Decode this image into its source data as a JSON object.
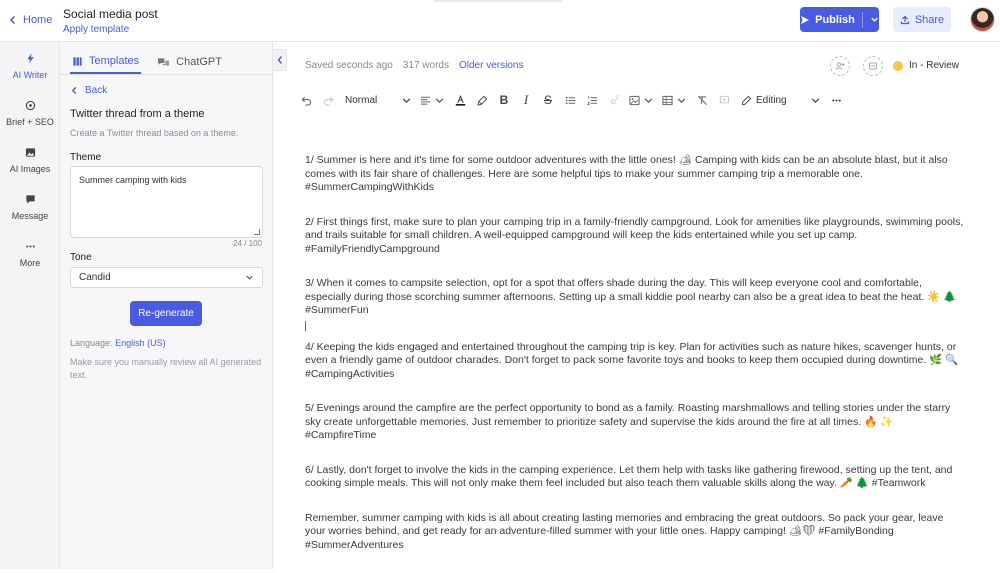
{
  "header": {
    "home_label": "Home",
    "doc_title": "Social media post",
    "apply_template": "Apply template",
    "publish_label": "Publish",
    "share_label": "Share"
  },
  "rail": {
    "items": [
      {
        "label": "AI Writer",
        "icon": "bolt-icon"
      },
      {
        "label": "Brief + SEO",
        "icon": "target-icon"
      },
      {
        "label": "AI Images",
        "icon": "image-icon"
      },
      {
        "label": "Message",
        "icon": "chat-icon"
      },
      {
        "label": "More",
        "icon": "more-icon"
      }
    ]
  },
  "panel": {
    "tabs": [
      "Templates",
      "ChatGPT"
    ],
    "back_label": "Back",
    "title": "Twitter thread from a theme",
    "subtitle": "Create a Twitter thread based on a theme.",
    "theme_label": "Theme",
    "theme_value": "Summer camping with kids",
    "char_count": "24 / 100",
    "tone_label": "Tone",
    "tone_value": "Candid",
    "regenerate_label": "Re-generate",
    "language_prefix": "Language:",
    "language_value": "English (US)",
    "note": "Make sure you manually review all AI generated text."
  },
  "editor_status": {
    "saved": "Saved seconds ago",
    "words": "317 words",
    "older_versions": "Older versions",
    "review_status": "In - Review"
  },
  "toolbar": {
    "style_value": "Normal",
    "mode_value": "Editing"
  },
  "content": {
    "paragraphs": [
      "1/ Summer is here and it's time for some outdoor adventures with the little ones! 🏕 Camping with kids can be an absolute blast, but it also comes with its fair share of challenges. Here are some helpful tips to make your summer camping trip a memorable one. #SummerCampingWithKids",
      "2/ First things first, make sure to plan your camping trip in a family-friendly campground. Look for amenities like playgrounds, swimming pools, and trails suitable for small children. A well-equipped campground will keep the kids entertained while you set up camp. #FamilyFriendlyCampground",
      "3/ When it comes to campsite selection, opt for a spot that offers shade during the day. This will keep everyone cool and comfortable, especially during those scorching summer afternoons. Setting up a small kiddie pool nearby can also be a great idea to beat the heat. ☀️ 🌲 #SummerFun",
      "4/ Keeping the kids engaged and entertained throughout the camping trip is key. Plan for activities such as nature hikes, scavenger hunts, or even a friendly game of outdoor charades. Don't forget to pack some favorite toys and books to keep them occupied during downtime. 🌿 🔍 #CampingActivities",
      "5/ Evenings around the campfire are the perfect opportunity to bond as a family. Roasting marshmallows and telling stories under the starry sky create unforgettable memories. Just remember to prioritize safety and supervise the kids around the fire at all times. 🔥 ✨ #CampfireTime",
      "6/ Lastly, don't forget to involve the kids in the camping experience. Let them help with tasks like gathering firewood, setting up the tent, and cooking simple meals. This will not only make them feel included but also teach them valuable skills along the way. 🥕 🌲 #Teamwork",
      "Remember, summer camping with kids is all about creating lasting memories and embracing the great outdoors. So pack your gear, leave your worries behind, and get ready for an adventure-filled summer with your little ones. Happy camping! 🏕❤ #FamilyBonding #SummerAdventures"
    ]
  },
  "colors": {
    "accent": "#4a5be3",
    "review_dot": "#f6c744"
  }
}
